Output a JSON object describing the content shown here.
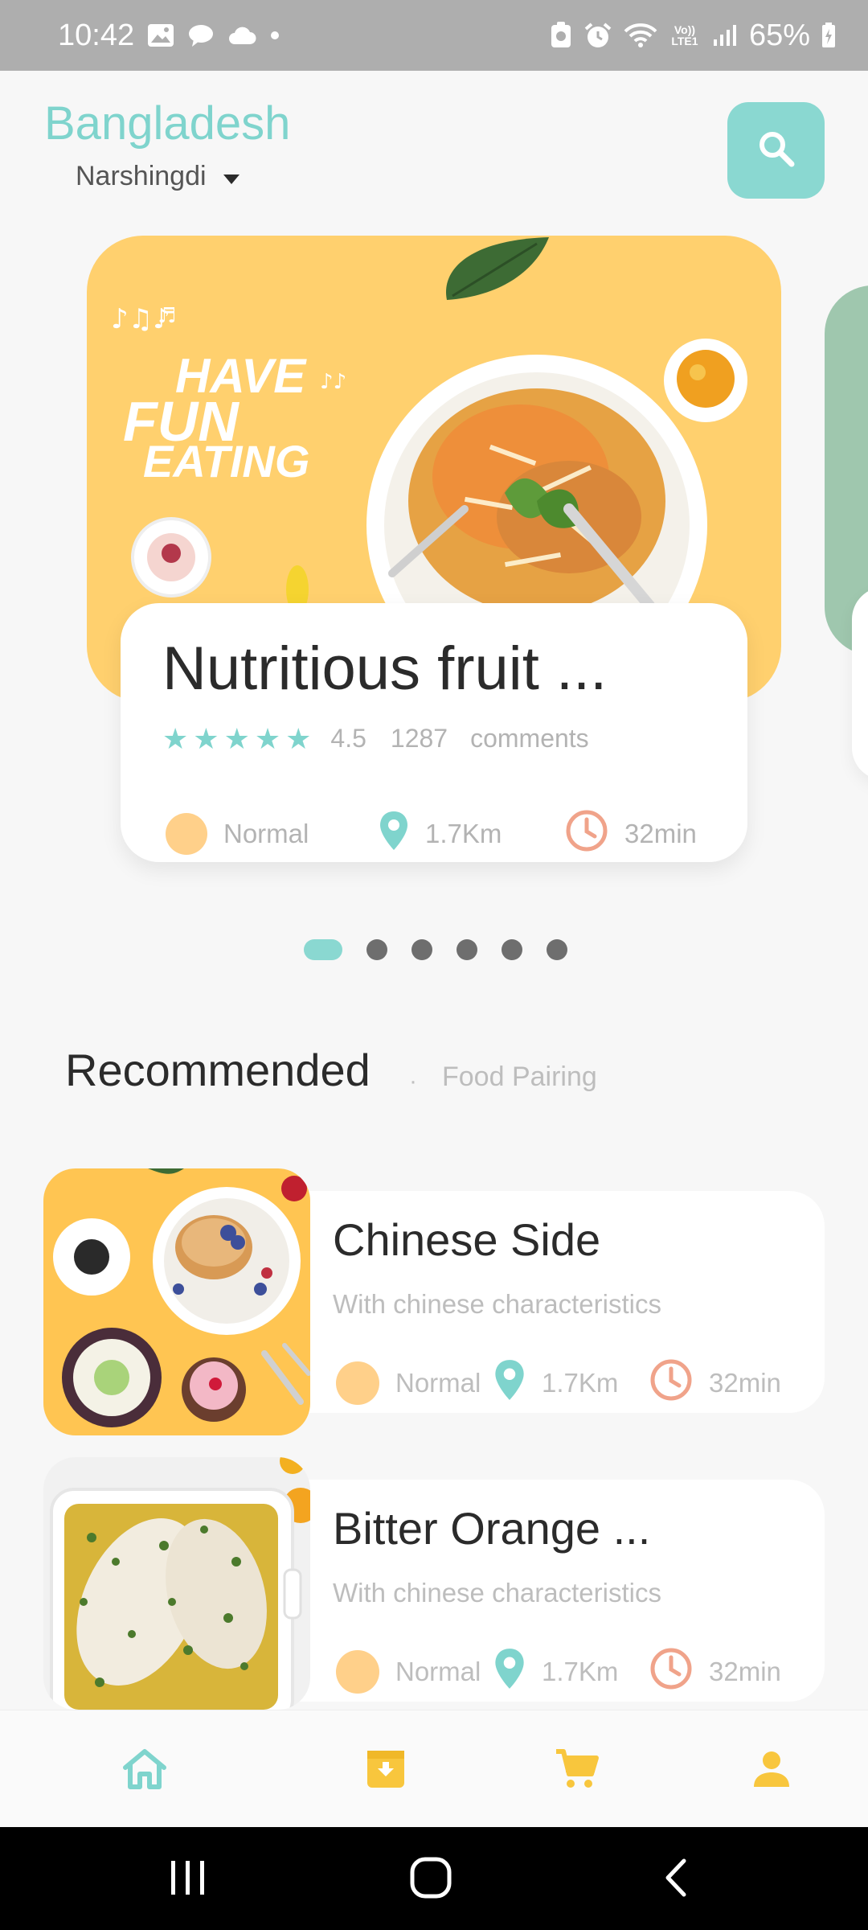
{
  "status_bar": {
    "time": "10:42",
    "battery": "65%",
    "icons": [
      "image-icon",
      "chat-icon",
      "cloud-icon",
      "dot-icon",
      "battery-saver-icon",
      "alarm-icon",
      "wifi-icon",
      "volte-icon",
      "signal-icon",
      "battery-icon"
    ],
    "volte_label": "Vo)) LTE1"
  },
  "header": {
    "country": "Bangladesh",
    "region": "Narshingdi",
    "search_icon": "search-icon"
  },
  "featured": {
    "title": "Nutritious fruit ...",
    "banner_text": "HAVE FUN EATING",
    "rating": "4.5",
    "stars": 5,
    "comments_count": "1287",
    "comments_label": "comments",
    "difficulty": "Normal",
    "distance": "1.7Km",
    "time": "32min"
  },
  "pager": {
    "total": 6,
    "active_index": 0
  },
  "section": {
    "title": "Recommended",
    "separator": "·",
    "subtitle": "Food Pairing"
  },
  "recommended": [
    {
      "title": "Chinese Side",
      "description": "With chinese characteristics",
      "difficulty": "Normal",
      "distance": "1.7Km",
      "time": "32min"
    },
    {
      "title": "Bitter Orange ...",
      "description": "With chinese characteristics",
      "difficulty": "Normal",
      "distance": "1.7Km",
      "time": "32min"
    }
  ],
  "bottom_nav": {
    "items": [
      "home-icon",
      "archive-icon",
      "cart-icon",
      "profile-icon"
    ],
    "active": "home-icon"
  },
  "colors": {
    "accent": "#8ad8d1",
    "accent_text": "#7fd4cd",
    "banner_yellow": "#ffd06e",
    "nav_yellow": "#f8c63d",
    "time_orange": "#f0a38a",
    "difficulty_dot": "#ffd08a"
  }
}
